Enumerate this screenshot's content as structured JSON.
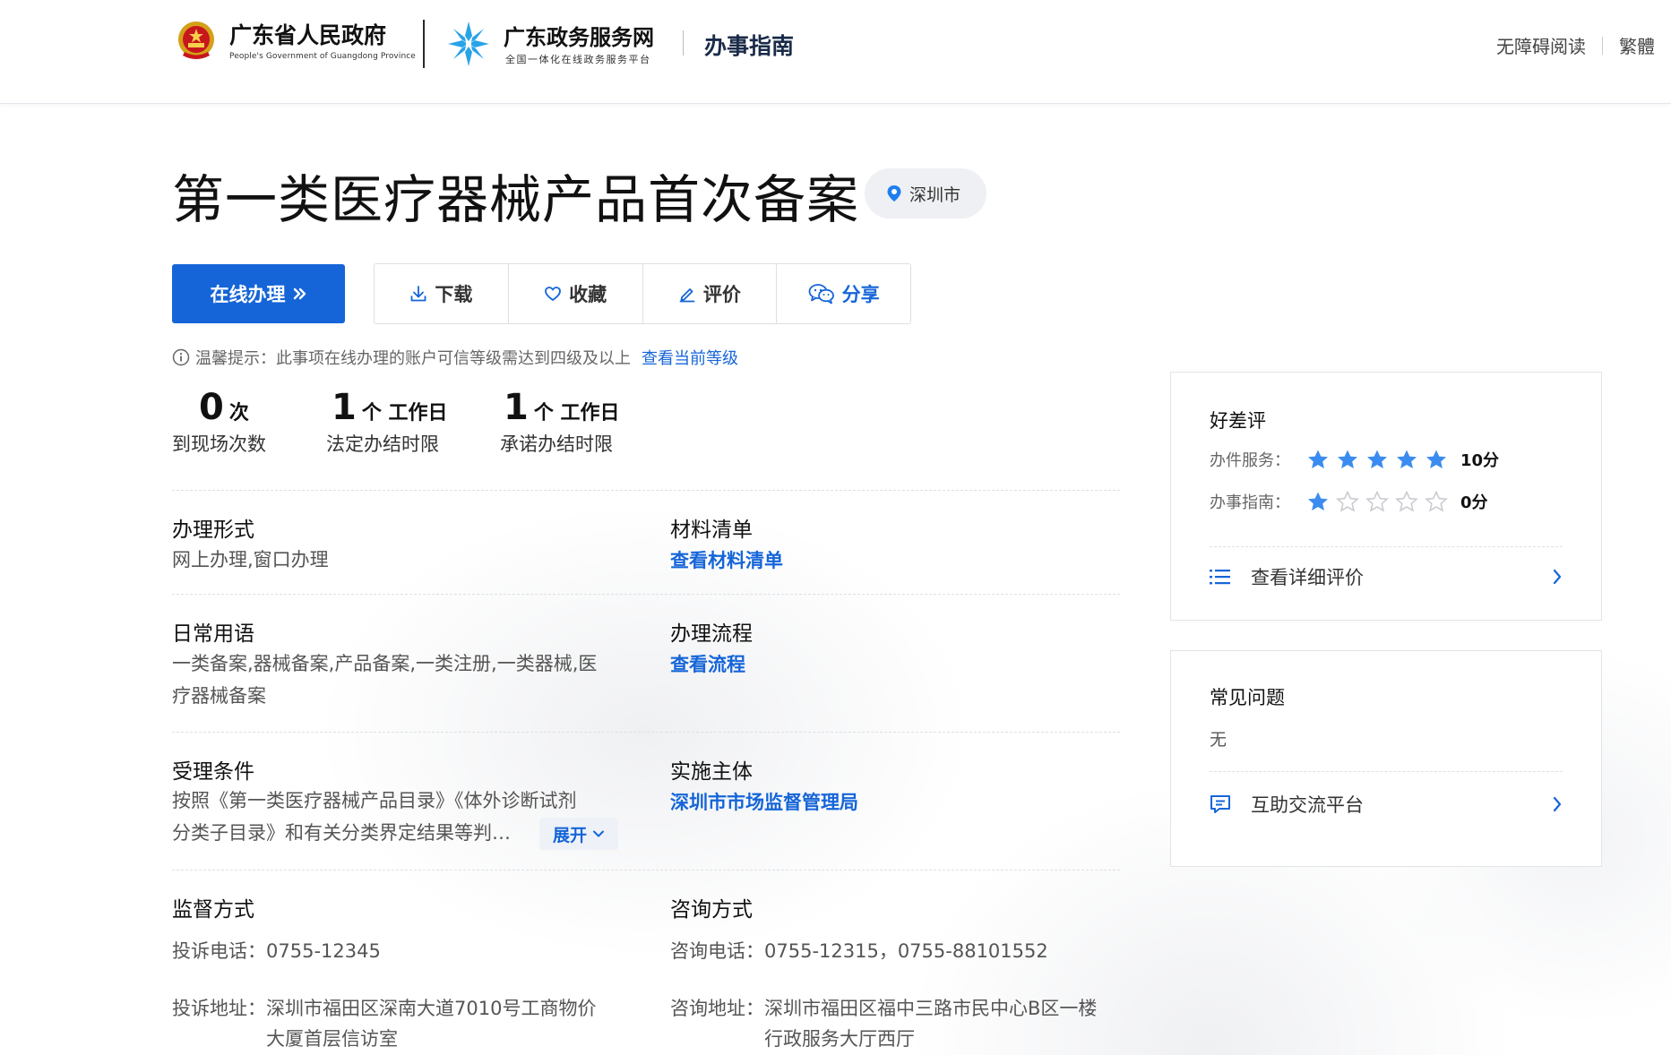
{
  "header": {
    "gov_name": "广东省人民政府",
    "gov_name_en": "People's Government of Guangdong Province",
    "service_name": "广东政务服务网",
    "service_subtitle": "全国一体化在线政务服务平台",
    "section_title": "办事指南",
    "links": [
      "无障碍阅读",
      "繁體"
    ]
  },
  "page": {
    "title": "第一类医疗器械产品首次备案",
    "location": "深圳市"
  },
  "actions": {
    "online": "在线办理",
    "download": "下载",
    "favorite": "收藏",
    "rate": "评价",
    "share": "分享"
  },
  "tip": {
    "text": "温馨提示：此事项在线办理的账户可信等级需达到四级及以上",
    "link": "查看当前等级"
  },
  "stats": [
    {
      "num": "0",
      "unit": "次",
      "label": "到现场次数"
    },
    {
      "num": "1",
      "unit": "个 工作日",
      "label": "法定办结时限"
    },
    {
      "num": "1",
      "unit": "个 工作日",
      "label": "承诺办结时限"
    }
  ],
  "sections": {
    "form": {
      "title": "办理形式",
      "text": "网上办理,窗口办理"
    },
    "materials": {
      "title": "材料清单",
      "link": "查看材料清单"
    },
    "terms": {
      "title": "日常用语",
      "line1": "一类备案,器械备案,产品备案,一类注册,一类器械,医",
      "line2": "疗器械备案"
    },
    "process": {
      "title": "办理流程",
      "link": "查看流程"
    },
    "conditions": {
      "title": "受理条件",
      "line1": "按照《第一类医疗器械产品目录》《体外诊断试剂",
      "line2": "分类子目录》和有关分类界定结果等判…",
      "expand": "展开"
    },
    "subject": {
      "title": "实施主体",
      "link": "深圳市市场监督管理局"
    },
    "supervision": {
      "title": "监督方式",
      "phone_key": "投诉电话：",
      "phone": "0755-12345",
      "addr_key": "投诉地址：",
      "addr_line1": "深圳市福田区深南大道7010号工商物价",
      "addr_line2": "大厦首层信访室"
    },
    "consult": {
      "title": "咨询方式",
      "phone_key": "咨询电话：",
      "phone": "0755-12315，0755-88101552",
      "addr_key": "咨询地址：",
      "addr_line1": "深圳市福田区福中三路市民中心B区一楼",
      "addr_line2": "行政服务大厅西厅"
    }
  },
  "rating_panel": {
    "title": "好差评",
    "rows": [
      {
        "label": "办件服务：",
        "stars": 5,
        "score": "10分"
      },
      {
        "label": "办事指南：",
        "stars": 1,
        "score": "0分"
      }
    ],
    "link": "查看详细评价"
  },
  "faq_panel": {
    "title": "常见问题",
    "text": "无",
    "link": "互助交流平台"
  },
  "colors": {
    "primary": "#1565d8",
    "star_on": "#3b8cf0",
    "star_off": "#c9ccd1"
  }
}
